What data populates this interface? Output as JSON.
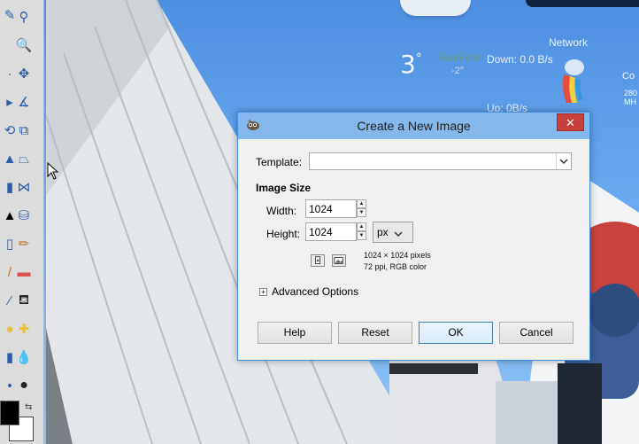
{
  "desktop": {
    "weather": {
      "temp": "3",
      "deg": "°",
      "realfeel_label": "RealFeel",
      "realfeel_value": "-2°"
    },
    "network": {
      "title": "Network",
      "down": "Down: 0.0 B/s",
      "up": "Up: 0B/s"
    },
    "clock": {
      "co": "Co",
      "line1": "280",
      "line2": "MH"
    }
  },
  "toolbox": {
    "tools": [
      "lasso-icon",
      "zoom-icon",
      "move-icon",
      "measure-icon",
      "align-icon",
      "perspective-icon",
      "flip-icon",
      "cage-icon",
      "text-icon",
      "bucket-icon",
      "pencil-icon",
      "eraser-icon",
      "ink-icon",
      "heal-icon",
      "blur-icon",
      "dodge-icon"
    ]
  },
  "dialog": {
    "title": "Create a New Image",
    "close": "✕",
    "template_label": "Template:",
    "template_value": "",
    "image_size_label": "Image Size",
    "width_label": "Width:",
    "width_value": "1024",
    "height_label": "Height:",
    "height_value": "1024",
    "unit": "px",
    "info_line1": "1024 × 1024 pixels",
    "info_line2": "72 ppi, RGB color",
    "advanced_label": "Advanced Options",
    "buttons": {
      "help": "Help",
      "reset": "Reset",
      "ok": "OK",
      "cancel": "Cancel"
    }
  },
  "colors": {
    "title_bar": "#85b9ed",
    "close": "#c7403a",
    "dialog_bg": "#f0f0f0",
    "sky": "#66a7ef"
  }
}
